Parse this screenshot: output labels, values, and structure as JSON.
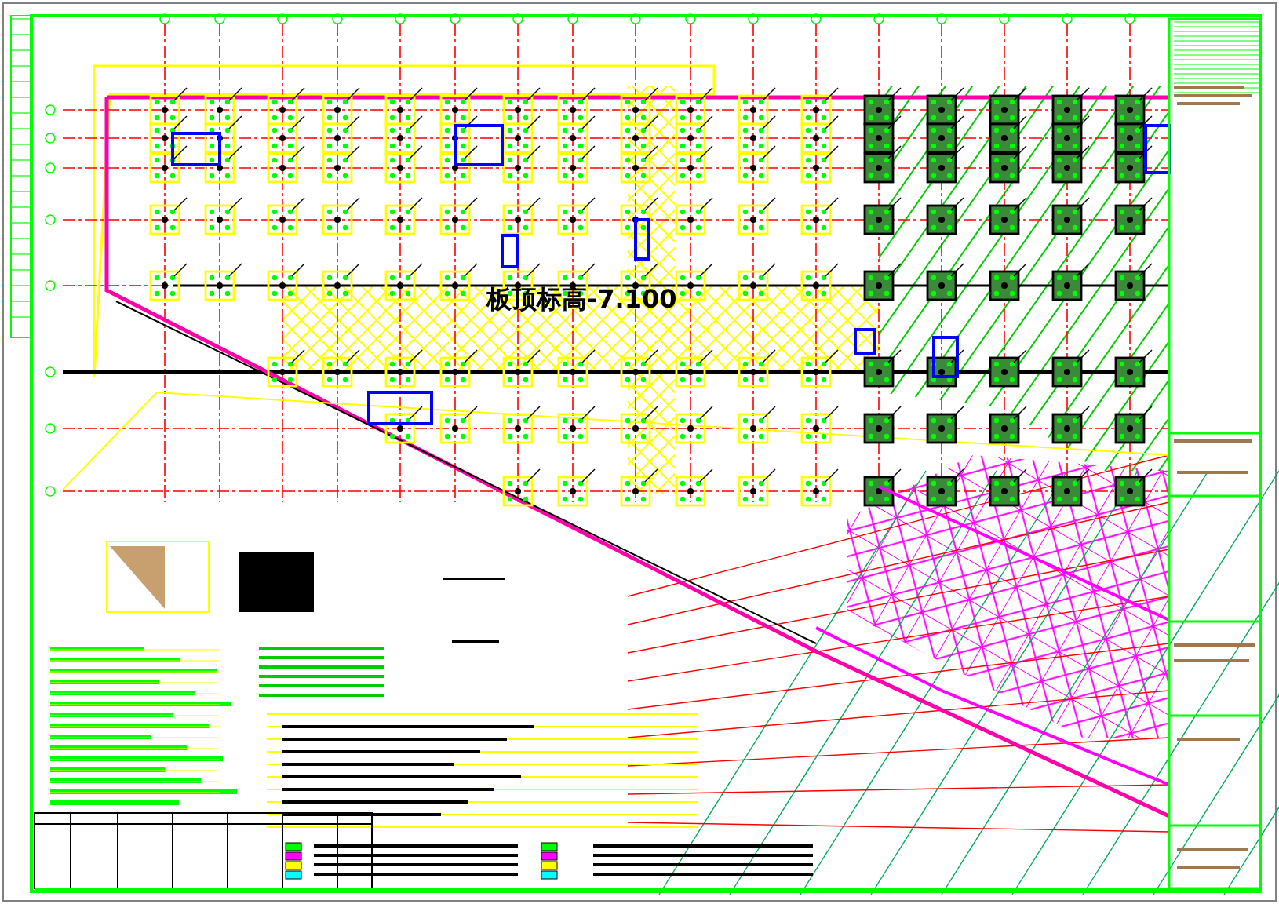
{
  "drawing": {
    "elevation_label": "板顶标高-7.100"
  }
}
